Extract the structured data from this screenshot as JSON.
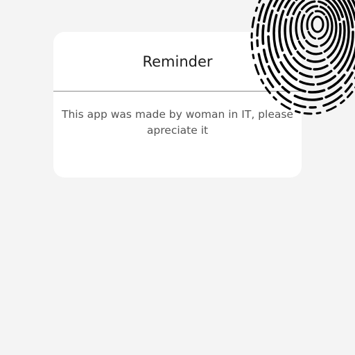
{
  "dialog": {
    "title": "Reminder",
    "message": "This app was made by woman in IT, please apreciate it"
  },
  "decoration": {
    "icon": "fingerprint-icon",
    "color": "#000000"
  },
  "colors": {
    "background": "#f4f4f4",
    "card": "#ffffff",
    "divider": "#8a8a8a",
    "title_text": "#1c1c1c",
    "body_text": "#555555"
  }
}
